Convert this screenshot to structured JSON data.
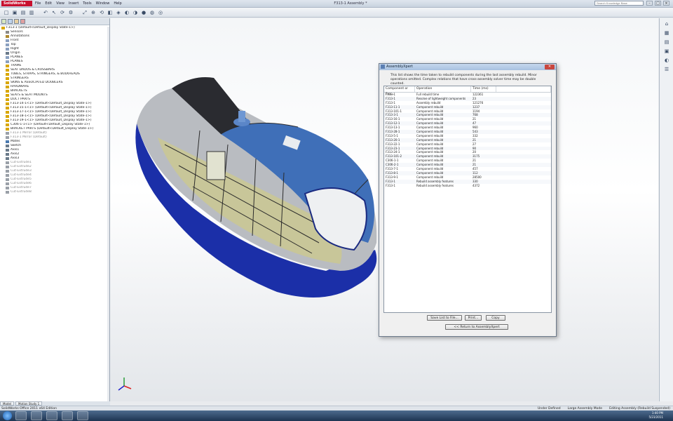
{
  "app": {
    "logo": "SolidWorks",
    "menu": [
      "File",
      "Edit",
      "View",
      "Insert",
      "Tools",
      "Window",
      "Help"
    ],
    "title": "F313-1 Assembly *",
    "search_placeholder": "Search Knowledge Base",
    "window_controls": [
      "–",
      "□",
      "×"
    ]
  },
  "toolbar_icons": [
    "new-icon",
    "open-icon",
    "save-icon",
    "print-icon",
    "undo-icon",
    "select-icon",
    "rebuild-icon",
    "options-icon",
    "zoom-fit-icon",
    "zoom-area-icon",
    "rotate-icon",
    "section-icon",
    "view-orient-icon",
    "display-style-icon",
    "hide-show-icon",
    "appearance-icon",
    "scene-icon",
    "view-settings-icon"
  ],
  "tree": {
    "items": [
      {
        "label": "F313-1 (Default<Default_Display State-1>)",
        "dim": false,
        "color": "#d9a700"
      },
      {
        "label": "Sensors",
        "dim": false,
        "color": "#8a8a8a"
      },
      {
        "label": "Annotations",
        "dim": false,
        "color": "#b08a30"
      },
      {
        "label": "Front",
        "dim": false,
        "color": "#8aa0c0"
      },
      {
        "label": "Top",
        "dim": false,
        "color": "#8aa0c0"
      },
      {
        "label": "Right",
        "dim": false,
        "color": "#8aa0c0"
      },
      {
        "label": "Origin",
        "dim": false,
        "color": "#6a7a8a"
      },
      {
        "label": "PLANES",
        "dim": false,
        "color": "#8aa0c0"
      },
      {
        "label": "PLANES",
        "dim": false,
        "color": "#8aa0c0"
      },
      {
        "label": "TRAME",
        "dim": false,
        "color": "#d9a700"
      },
      {
        "label": "SEAT DADOS & CROSSBARS",
        "dim": false,
        "color": "#d9a700"
      },
      {
        "label": "TUBES, STRAPS, STRINGERS, & BULKHEADS",
        "dim": false,
        "color": "#d9a700"
      },
      {
        "label": "STRINGERS",
        "dim": false,
        "color": "#d9a700"
      },
      {
        "label": "SKINS & ASSOCIATED DOUBLERS",
        "dim": false,
        "color": "#d9a700"
      },
      {
        "label": "HARDWARE",
        "dim": false,
        "color": "#d9a700"
      },
      {
        "label": "BRACKETS",
        "dim": false,
        "color": "#d9a700"
      },
      {
        "label": "SEATS & SEAT MOUNTS",
        "dim": false,
        "color": "#d9a700"
      },
      {
        "label": "DUCT PARTS",
        "dim": false,
        "color": "#d9a700"
      },
      {
        "label": "F313-14-1<1> (Default<Default_Display State-1>)",
        "dim": false,
        "color": "#d9a700"
      },
      {
        "label": "F313-15-1<1> (Default<Default_Display State-1>)",
        "dim": false,
        "color": "#d9a700"
      },
      {
        "label": "F313-17-1<1> (Default<Default_Display State-1>)",
        "dim": false,
        "color": "#d9a700"
      },
      {
        "label": "F313-18-1<1> (Default<Default_Display State-1>)",
        "dim": false,
        "color": "#d9a700"
      },
      {
        "label": "F313-19-1<1> (Default<Default_Display State-1>)",
        "dim": false,
        "color": "#d9a700"
      },
      {
        "label": "C306-1-1<1> (Default<Default_Display State-1>)",
        "dim": false,
        "color": "#d9a700"
      },
      {
        "label": "BRACKET PARTS (Default<Default_Display State-1>)",
        "dim": false,
        "color": "#d9a700"
      },
      {
        "label": "F313-1 Mirror (Default)",
        "dim": true,
        "color": "#9aa0a8"
      },
      {
        "label": "F313-1 Mirror (Default)",
        "dim": true,
        "color": "#9aa0a8"
      },
      {
        "label": "Mates",
        "dim": false,
        "color": "#4a7ab0"
      },
      {
        "label": "Sketch",
        "dim": false,
        "color": "#6a7a8a"
      },
      {
        "label": "Axis1",
        "dim": false,
        "color": "#6a7a8a"
      },
      {
        "label": "Axis2",
        "dim": false,
        "color": "#6a7a8a"
      },
      {
        "label": "Axis3",
        "dim": false,
        "color": "#6a7a8a"
      },
      {
        "label": "Cut-Extrude1",
        "dim": true,
        "color": "#9aa0a8"
      },
      {
        "label": "Cut-Extrude2",
        "dim": true,
        "color": "#9aa0a8"
      },
      {
        "label": "Cut-Extrude3",
        "dim": true,
        "color": "#9aa0a8"
      },
      {
        "label": "Cut-Extrude4",
        "dim": true,
        "color": "#9aa0a8"
      },
      {
        "label": "Cut-Extrude5",
        "dim": true,
        "color": "#9aa0a8"
      },
      {
        "label": "Cut-Extrude6",
        "dim": true,
        "color": "#9aa0a8"
      },
      {
        "label": "Cut-Extrude7",
        "dim": true,
        "color": "#9aa0a8"
      },
      {
        "label": "Cut-Extrude8",
        "dim": true,
        "color": "#9aa0a8"
      }
    ]
  },
  "dialog": {
    "title": "AssemblyXpert",
    "description": "This list shows the time taken to rebuild components during the last assembly rebuild. Minor operations omitted. Complex relations that have cross-assembly solver time may be double counted.",
    "columns": [
      "Component or Fea...",
      "Operation",
      "Time (ms)",
      ""
    ],
    "rows": [
      [
        "F313-1",
        "Full rebuild time",
        "122361",
        ""
      ],
      [
        "F313-1",
        "Resolve of lightweight components",
        "23",
        ""
      ],
      [
        "F313-1",
        "Assembly rebuild",
        "121276",
        ""
      ],
      [
        "F313-11-1",
        "Component rebuild",
        "1237",
        ""
      ],
      [
        "F313-101-1",
        "Component rebuild",
        "1194",
        ""
      ],
      [
        "F313-3-1",
        "Component rebuild",
        "768",
        ""
      ],
      [
        "F313-16-1",
        "Component rebuild",
        "21",
        ""
      ],
      [
        "F313-12-1",
        "Component rebuild",
        "47",
        ""
      ],
      [
        "F313-13-1",
        "Component rebuild",
        "960",
        ""
      ],
      [
        "F313-28-1",
        "Component rebuild",
        "543",
        ""
      ],
      [
        "F313-5-1",
        "Component rebuild",
        "332",
        ""
      ],
      [
        "F313-20-1",
        "Component rebuild",
        "21",
        ""
      ],
      [
        "F313-22-1",
        "Component rebuild",
        "27",
        ""
      ],
      [
        "F313-23-1",
        "Component rebuild",
        "90",
        ""
      ],
      [
        "F313-24-1",
        "Component rebuild",
        "20",
        ""
      ],
      [
        "F313-101-2",
        "Component rebuild",
        "3175",
        ""
      ],
      [
        "C306-1-1",
        "Component rebuild",
        "21",
        ""
      ],
      [
        "C306-2-1",
        "Component rebuild",
        "21",
        ""
      ],
      [
        "F313-7-1",
        "Component rebuild",
        "457",
        ""
      ],
      [
        "F313-8-1",
        "Component rebuild",
        "112",
        ""
      ],
      [
        "F313-9-1",
        "Component rebuild",
        "28500",
        ""
      ],
      [
        "F313-1",
        "Rebuild assembly features",
        "330",
        ""
      ],
      [
        "F313-1",
        "Rebuild assembly features",
        "4372",
        ""
      ]
    ],
    "buttons": {
      "save": "Save List to File...",
      "print": "Print...",
      "copy": "Copy",
      "return": "<< Return to AssemblyXpert"
    }
  },
  "bottom_tabs": [
    "Model",
    "Motion Study 1"
  ],
  "status": {
    "left": "SolidWorks Office 2011 x64 Edition",
    "right": [
      "Under Defined",
      "Large Assembly Mode",
      "Editing Assembly (Rebuild Suspended)"
    ]
  },
  "clock": {
    "time": "1:40 PM",
    "date": "5/23/2011"
  },
  "taskbar_apps": [
    "ie-icon",
    "explorer-icon",
    "media-icon",
    "solidworks-icon",
    "network-icon"
  ],
  "taskpane_icons": [
    "home-icon",
    "design-library-icon",
    "file-explorer-icon",
    "view-palette-icon",
    "appearances-icon",
    "custom-properties-icon"
  ]
}
